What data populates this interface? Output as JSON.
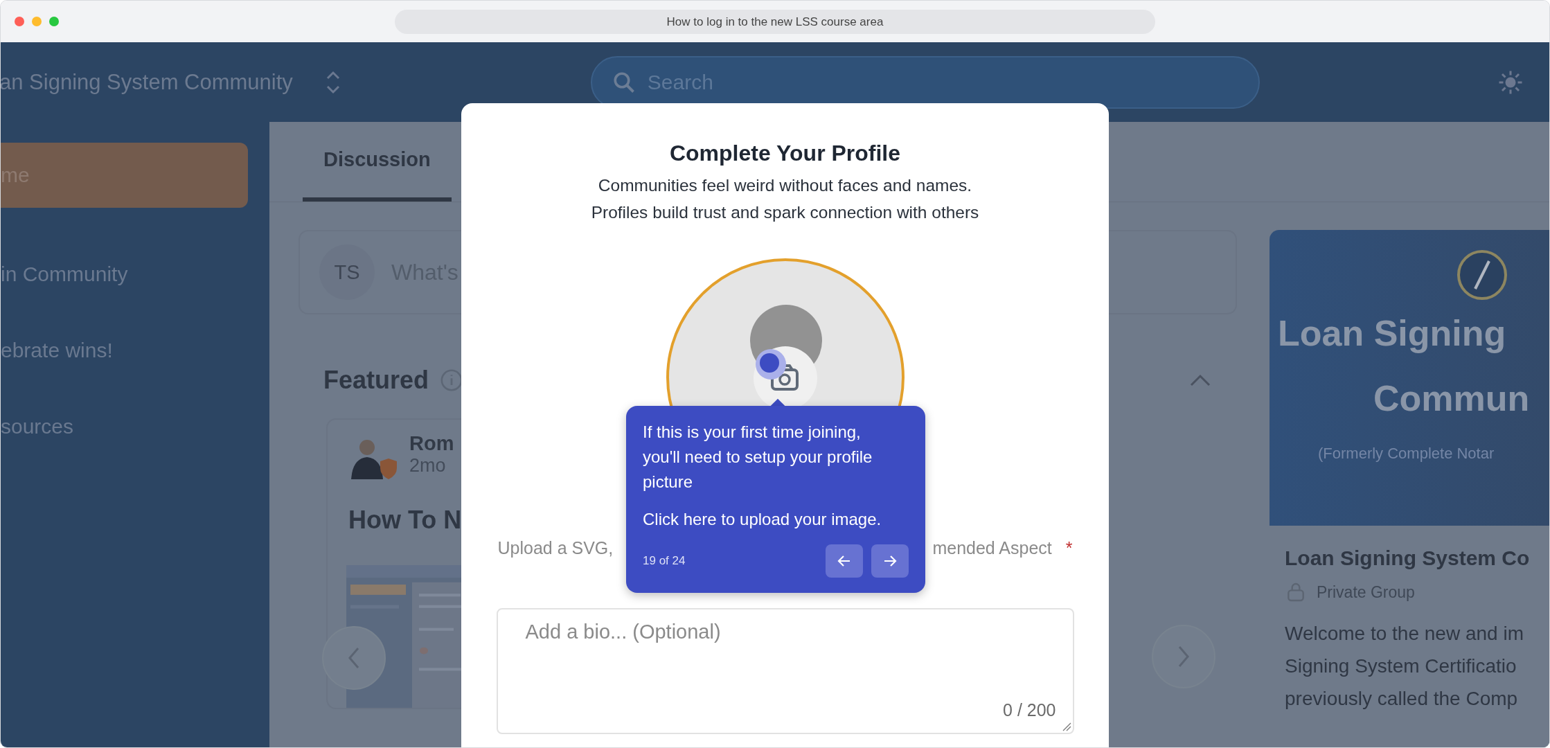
{
  "browser": {
    "title": "How to log in to the new LSS course area"
  },
  "header": {
    "community_name": "an Signing System Community",
    "search": {
      "placeholder": "Search"
    }
  },
  "sidebar": {
    "items": [
      {
        "label": "me",
        "selected": true
      },
      {
        "label": "in Community",
        "selected": false
      },
      {
        "label": "ebrate wins!",
        "selected": false
      },
      {
        "label": "sources",
        "selected": false
      }
    ]
  },
  "tabs": [
    {
      "label": "Discussion",
      "selected": true
    }
  ],
  "composer": {
    "avatar_initials": "TS",
    "placeholder": "What's"
  },
  "featured": {
    "title": "Featured",
    "post": {
      "author": "Rom",
      "time": "2mo",
      "title": "How To N"
    }
  },
  "group_card": {
    "banner_lines": [
      "Loan Signing",
      "Commun"
    ],
    "banner_subtitle": "(Formerly Complete Notar",
    "name": "Loan Signing System Co",
    "privacy": "Private Group",
    "description_lines": [
      "Welcome to the new and im",
      "Signing System Certificatio",
      "previously called the Comp"
    ]
  },
  "modal": {
    "title": "Complete Your Profile",
    "subtitle_lines": [
      "Communities feel weird without faces and names.",
      "Profiles build trust and spark connection with others"
    ],
    "upload_hint_start": "Upload a SVG,",
    "upload_hint_end": "mended Aspect",
    "required_mark": "*",
    "bio": {
      "placeholder": "Add a bio... (Optional)",
      "counter": "0 / 200"
    }
  },
  "tour_tooltip": {
    "paragraphs": [
      "If this is your first time joining, you'll need to setup your profile picture",
      "Click here to upload your image."
    ],
    "progress": "19 of 24"
  }
}
